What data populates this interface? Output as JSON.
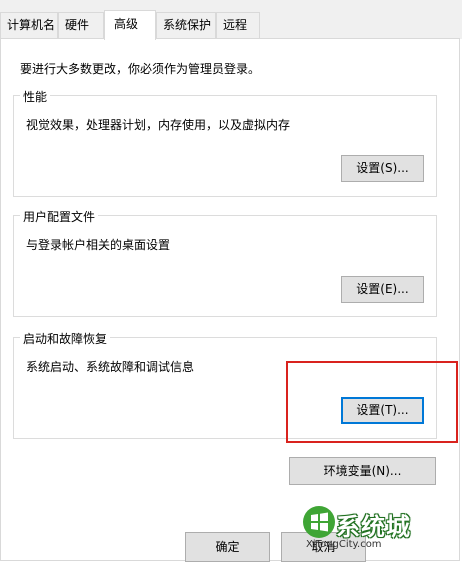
{
  "tabs": [
    {
      "label": "计算机名"
    },
    {
      "label": "硬件"
    },
    {
      "label": "高级",
      "active": true
    },
    {
      "label": "系统保护"
    },
    {
      "label": "远程"
    }
  ],
  "admin_note": "要进行大多数更改，你必须作为管理员登录。",
  "performance": {
    "title": "性能",
    "description": "视觉效果，处理器计划，内存使用，以及虚拟内存",
    "button": "设置(S)..."
  },
  "user_profiles": {
    "title": "用户配置文件",
    "description": "与登录帐户相关的桌面设置",
    "button": "设置(E)..."
  },
  "startup_recovery": {
    "title": "启动和故障恢复",
    "description": "系统启动、系统故障和调试信息",
    "button": "设置(T)..."
  },
  "env_button": "环境变量(N)...",
  "footer": {
    "ok": "确定",
    "cancel": "取消"
  },
  "watermark": {
    "brand": "系统城",
    "site": "XiTongCity.com"
  },
  "colors": {
    "highlight": "#d9231e",
    "focus": "#0078d7",
    "button_bg": "#e1e1e1"
  }
}
